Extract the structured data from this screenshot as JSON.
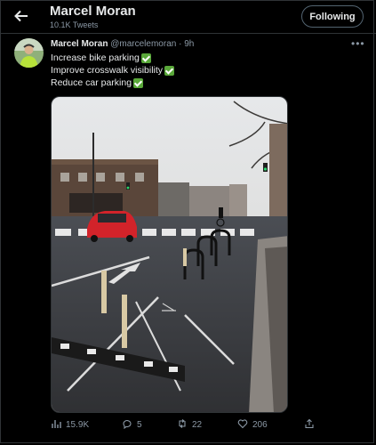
{
  "header": {
    "name": "Marcel Moran",
    "tweet_count": "10.1K Tweets",
    "follow_label": "Following"
  },
  "tweet": {
    "author": "Marcel Moran",
    "handle": "@marcelemoran",
    "separator": "·",
    "time": "9h",
    "lines": [
      "Increase bike parking",
      "Improve crosswalk visibility",
      "Reduce car parking"
    ],
    "stats": {
      "views": "15.9K",
      "replies": "5",
      "retweets": "22",
      "likes": "206"
    }
  },
  "icons": {
    "back": "arrow-left-icon",
    "more": "more-dots-icon",
    "views": "bar-chart-icon",
    "reply": "speech-bubble-icon",
    "retweet": "retweet-icon",
    "like": "heart-icon",
    "share": "share-icon",
    "check": "green-check-emoji"
  },
  "colors": {
    "background": "#000000",
    "text": "#e7e9ea",
    "muted": "#8b98a5",
    "check": "#5aa83a"
  }
}
